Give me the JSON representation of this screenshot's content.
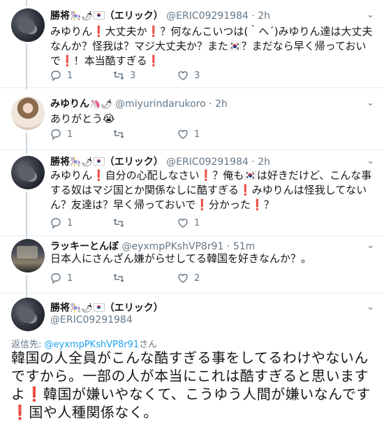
{
  "tweets": [
    {
      "name": "勝将",
      "handle": "@ERIC09291984",
      "time": "2h",
      "nick": "（エリック）",
      "body": "みゆりん❗大丈夫か❗？何なんこいつは(｀へ´)みゆりん達は大丈夫なんか？怪我は？マジ大丈夫か？また🇰🇷？まだなら早く帰っておいで❗！本当酷すぎる❗",
      "reply_count": "1",
      "retweet_count": "3",
      "like_count": "3"
    },
    {
      "name": "みゆりん",
      "handle": "@miyurindarukoro",
      "time": "2h",
      "body": "ありがとう😭",
      "reply_count": "1",
      "retweet_count": "",
      "like_count": "1"
    },
    {
      "name": "勝将",
      "handle": "@ERIC09291984",
      "time": "2h",
      "nick": "（エリック）",
      "body": "みゆりん❗自分の心配しなさい❗？俺も🇰🇷は好きだけど、こんな事する奴はマジ国とか関係なしに酷すぎる❗みゆりんは怪我してないん？友達は？早く帰っておいで❗分かった❗？",
      "reply_count": "1",
      "retweet_count": "",
      "like_count": "1"
    },
    {
      "name": "ラッキーとんぼ",
      "handle": "@eyxmpPKshVP8r91",
      "time": "51m",
      "body": "日本人にさんざん嫌がらせしてる韓国を好きなんか？。",
      "reply_count": "1",
      "retweet_count": "",
      "like_count": "2"
    }
  ],
  "main_tweet": {
    "name": "勝将",
    "nick": "（エリック）",
    "handle": "@ERIC09291984",
    "replying_prefix": "返信先:",
    "replying_handle": "@eyxmpPKshVP8r91",
    "replying_suffix": "さん",
    "line1": "韓国の人全員がこんな酷すぎる事をしてるわけやないんですから。一部の人が本当にこれは酷すぎると思いますよ",
    "line2": "韓国が嫌いやなくて、こうゆう人間が嫌いなんです",
    "line3": "国や人種関係なく。"
  },
  "icons": {
    "reply": "reply-icon",
    "retweet": "retweet-icon",
    "like": "heart-icon",
    "more": "chevron-down-icon"
  },
  "colors": {
    "text": "#14171a",
    "muted": "#657786",
    "link": "#1da1f2",
    "exclamation": "#e0245e",
    "divider": "#e6ecf0"
  }
}
